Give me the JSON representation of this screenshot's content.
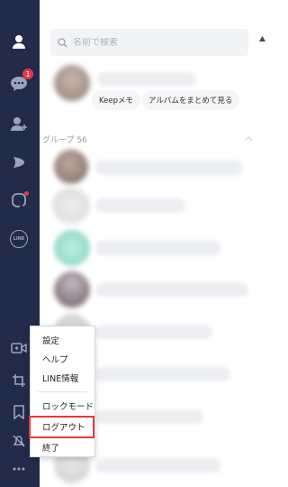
{
  "sidebar": {
    "chat_badge": "1",
    "line_icon_text": "LINE"
  },
  "search": {
    "placeholder": "名前で検索"
  },
  "profile": {
    "keep_chip": "Keepメモ",
    "album_chip": "アルバムをまとめて見る"
  },
  "groups": {
    "header": "グループ 56"
  },
  "context_menu": {
    "items": [
      "設定",
      "ヘルプ",
      "LINE情報",
      "ロックモード",
      "ログアウト",
      "終了"
    ],
    "highlighted": "ログアウト"
  },
  "colors": {
    "sidebar_bg": "#232b4a",
    "badge_red": "#e8364a",
    "highlight_red": "#e53939"
  }
}
